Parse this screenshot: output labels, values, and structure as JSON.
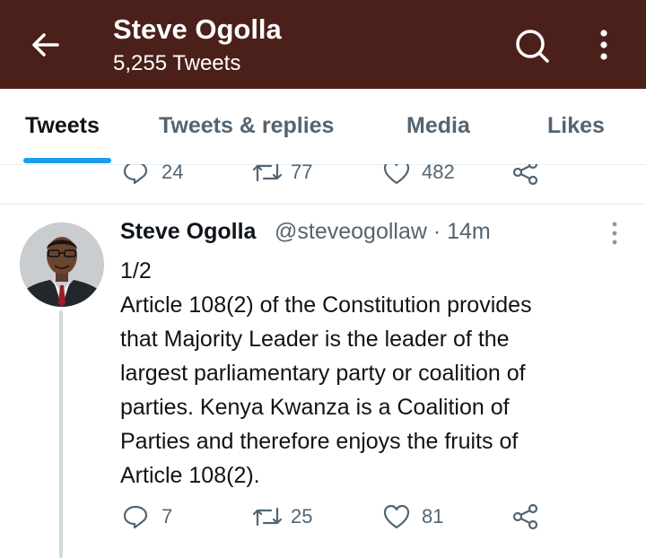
{
  "header": {
    "name": "Steve Ogolla",
    "tweet_count": "5,255 Tweets",
    "back_icon": "arrow-left-icon",
    "search_icon": "search-icon",
    "more_icon": "more-vertical-icon",
    "background": "#4b201a"
  },
  "tabs": [
    {
      "label": "Tweets",
      "active": true
    },
    {
      "label": "Tweets & replies",
      "active": false
    },
    {
      "label": "Media",
      "active": false
    },
    {
      "label": "Likes",
      "active": false
    }
  ],
  "previous_tweet": {
    "replies": "24",
    "retweets": "77",
    "likes": "482"
  },
  "tweet": {
    "author_name": "Steve Ogolla",
    "author_handle_time": "@steveogollaw · 14m",
    "lines": [
      "1/2",
      "Article 108(2) of the Constitution provides",
      "that Majority Leader is the leader of the",
      "largest parliamentary party or coalition of",
      "parties. Kenya Kwanza is a Coalition of",
      "Parties and therefore enjoys the fruits of",
      "Article 108(2)."
    ],
    "replies": "7",
    "retweets": "25",
    "likes": "81"
  },
  "colors": {
    "accent": "#1d9bf0",
    "muted_text": "#536471",
    "divider": "#e6ecf0"
  }
}
